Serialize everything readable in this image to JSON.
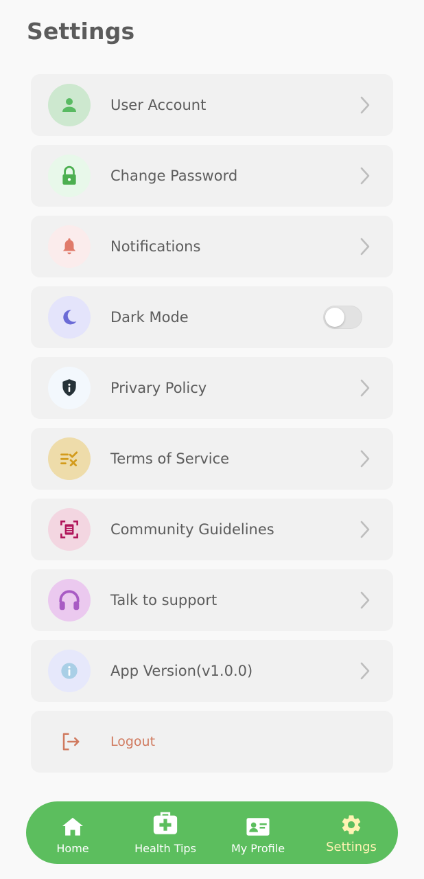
{
  "page": {
    "title": "Settings"
  },
  "settings": [
    {
      "label": "User Account",
      "icon": "person-icon",
      "circle": "#cde8cf",
      "color": "#59ba62"
    },
    {
      "label": "Change Password",
      "icon": "lock-icon",
      "circle": "#e8f8ea",
      "color": "#4caf50"
    },
    {
      "label": "Notifications",
      "icon": "bell-icon",
      "circle": "#fbecec",
      "color": "#e07a6a"
    },
    {
      "label": "Dark Mode",
      "icon": "moon-icon",
      "circle": "#e4e4fb",
      "color": "#6b6bd6",
      "toggle": false
    },
    {
      "label": "Privary Policy",
      "icon": "shield-icon",
      "circle": "#f3f8fd",
      "color": "#263238"
    },
    {
      "label": "Terms of Service",
      "icon": "checklist-icon",
      "circle": "#eedcaa",
      "color": "#d39b1c"
    },
    {
      "label": "Community Guidelines",
      "icon": "document-scan-icon",
      "circle": "#f3d6e1",
      "color": "#b0145a"
    },
    {
      "label": "Talk to support",
      "icon": "headset-icon",
      "circle": "#ebc9ef",
      "color": "#a85bc4"
    },
    {
      "label": "App Version(v1.0.0)",
      "icon": "info-icon",
      "circle": "#e6e8fb",
      "color": "#a9cfe6"
    }
  ],
  "logout": {
    "label": "Logout",
    "icon": "logout-icon",
    "color": "#d07a5f"
  },
  "nav": [
    {
      "label": "Home",
      "icon": "home-icon"
    },
    {
      "label": "Health Tips",
      "icon": "medical-kit-icon"
    },
    {
      "label": "My Profile",
      "icon": "id-card-icon"
    },
    {
      "label": "Settings",
      "icon": "gear-icon",
      "active": true
    }
  ],
  "colors": {
    "nav_bar": "#5cbe5e",
    "active_nav": "#fff3b3",
    "chevron": "#bdbdbd"
  }
}
